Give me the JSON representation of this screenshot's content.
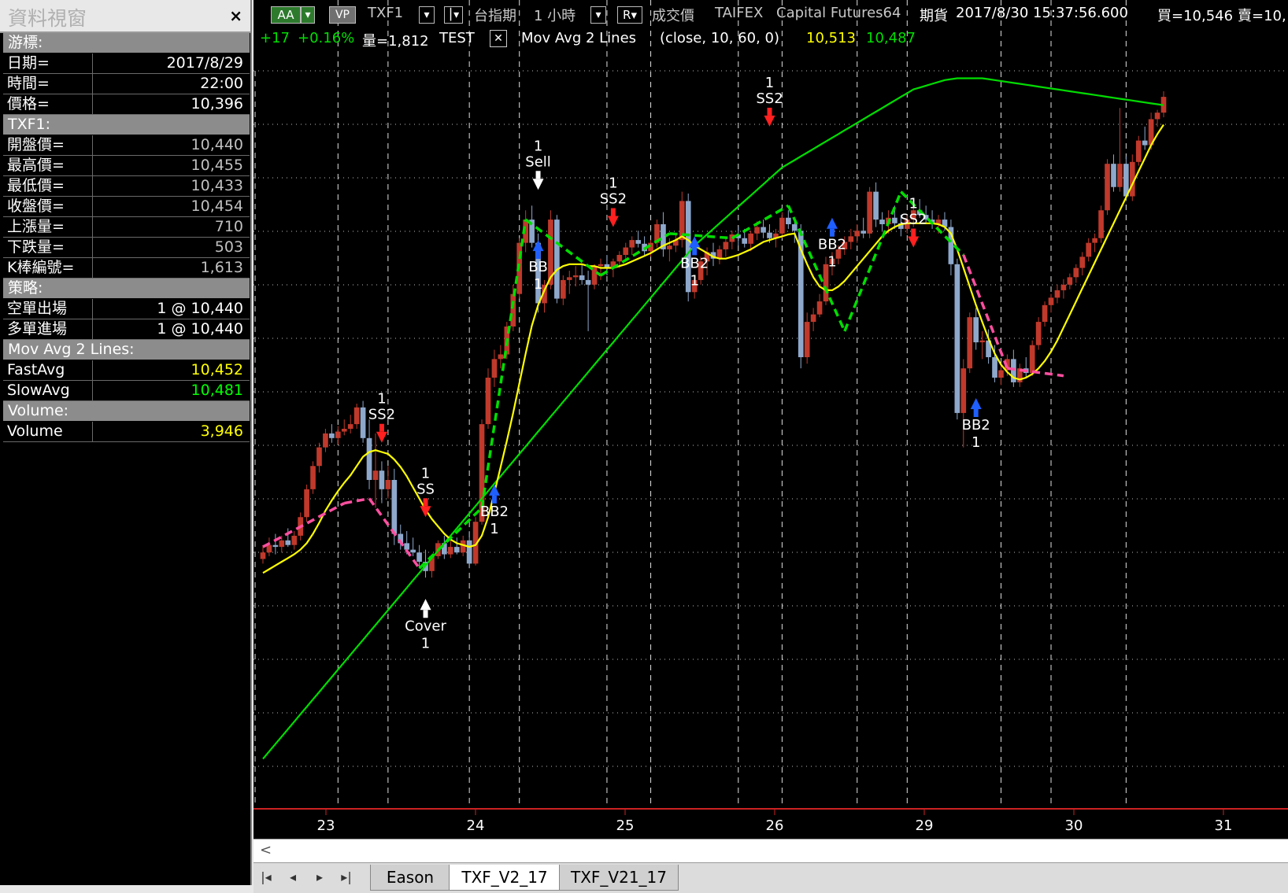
{
  "info_window": {
    "title": "資料視窗",
    "close": "×",
    "sections": [
      {
        "header": "游標:",
        "rows": [
          {
            "k": "日期=",
            "v": "2017/8/29",
            "c": "#ffffff"
          },
          {
            "k": "時間=",
            "v": "22:00",
            "c": "#ffffff"
          },
          {
            "k": "價格=",
            "v": "10,396",
            "c": "#ffffff"
          }
        ]
      },
      {
        "header": "TXF1:",
        "rows": [
          {
            "k": "開盤價=",
            "v": "10,440",
            "c": "#c0c0c0"
          },
          {
            "k": "最高價=",
            "v": "10,455",
            "c": "#c0c0c0"
          },
          {
            "k": "最低價=",
            "v": "10,433",
            "c": "#c0c0c0"
          },
          {
            "k": "收盤價=",
            "v": "10,454",
            "c": "#c0c0c0"
          },
          {
            "k": "上漲量=",
            "v": "710",
            "c": "#c0c0c0"
          },
          {
            "k": "下跌量=",
            "v": "503",
            "c": "#c0c0c0"
          },
          {
            "k": "K棒編號=",
            "v": "1,613",
            "c": "#c0c0c0"
          }
        ]
      },
      {
        "header": "策略:",
        "rows": [
          {
            "k": "空單出場",
            "v": "1 @ 10,440",
            "c": "#ffffff"
          },
          {
            "k": "多單進場",
            "v": "1 @ 10,440",
            "c": "#ffffff"
          }
        ]
      },
      {
        "header": "Mov Avg 2 Lines:",
        "rows": [
          {
            "k": "FastAvg",
            "v": "10,452",
            "c": "#ffff00"
          },
          {
            "k": "SlowAvg",
            "v": "10,481",
            "c": "#00ff00"
          }
        ]
      },
      {
        "header": "Volume:",
        "rows": [
          {
            "k": "Volume",
            "v": "3,946",
            "c": "#ffff00"
          }
        ]
      }
    ]
  },
  "header": {
    "btn_aa": "AA",
    "btn_vp": "VP",
    "symbol": "TXF1",
    "name": "台指期",
    "interval": "1 小時",
    "r": "R",
    "price_type": "成交價",
    "exchange": "TAIFEX",
    "source": "Capital Futures64",
    "kind": "期貨",
    "datetime": "2017/8/30  15:37:56.600",
    "bid": "買=10,546",
    "ask": "賣=10,"
  },
  "subheader": {
    "change": "+17",
    "change_pct": "+0.16%",
    "volume": "量=1,812",
    "strategy": "TEST",
    "close_box": "✕",
    "indicator": "Mov Avg 2 Lines",
    "params": "(close,  10,  60,  0)",
    "fast_value": "10,513",
    "slow_value": "10,487"
  },
  "tabs": [
    "Eason",
    "TXF_V2_17",
    "TXF_V21_17"
  ],
  "active_tab": 1,
  "colors": {
    "up": "#c0392b",
    "down": "#8ea8cc",
    "fast": "#ffff00",
    "slow": "#00dd00",
    "long": "#00dd00",
    "short": "#ff4fa0",
    "buy_arrow": "#1f5fff",
    "sell_arrow": "#ff2020",
    "exit_arrow": "#ffffff"
  },
  "chart_data": {
    "type": "candlestick",
    "x_ticks": [
      "23",
      "24",
      "25",
      "26",
      "29",
      "30",
      "31"
    ],
    "bars": [
      [
        10395,
        10410,
        10390,
        10402
      ],
      [
        10402,
        10418,
        10398,
        10410
      ],
      [
        10410,
        10422,
        10400,
        10408
      ],
      [
        10408,
        10420,
        10402,
        10415
      ],
      [
        10415,
        10428,
        10408,
        10410
      ],
      [
        10410,
        10425,
        10405,
        10420
      ],
      [
        10420,
        10445,
        10415,
        10440
      ],
      [
        10440,
        10475,
        10435,
        10470
      ],
      [
        10470,
        10500,
        10465,
        10495
      ],
      [
        10495,
        10520,
        10488,
        10515
      ],
      [
        10515,
        10535,
        10510,
        10530
      ],
      [
        10530,
        10540,
        10520,
        10525
      ],
      [
        10525,
        10538,
        10518,
        10532
      ],
      [
        10532,
        10545,
        10528,
        10535
      ],
      [
        10535,
        10550,
        10530,
        10540
      ],
      [
        10540,
        10562,
        10535,
        10558
      ],
      [
        10558,
        10565,
        10520,
        10525
      ],
      [
        10525,
        10545,
        10470,
        10480
      ],
      [
        10480,
        10530,
        10450,
        10490
      ],
      [
        10490,
        10500,
        10455,
        10470
      ],
      [
        10470,
        10495,
        10460,
        10480
      ],
      [
        10480,
        10492,
        10410,
        10422
      ],
      [
        10422,
        10432,
        10405,
        10412
      ],
      [
        10412,
        10425,
        10400,
        10405
      ],
      [
        10405,
        10418,
        10398,
        10402
      ],
      [
        10402,
        10410,
        10385,
        10392
      ],
      [
        10392,
        10405,
        10375,
        10382
      ],
      [
        10382,
        10400,
        10375,
        10398
      ],
      [
        10398,
        10415,
        10395,
        10412
      ],
      [
        10412,
        10420,
        10395,
        10400
      ],
      [
        10400,
        10415,
        10396,
        10408
      ],
      [
        10408,
        10418,
        10400,
        10402
      ],
      [
        10402,
        10420,
        10398,
        10415
      ],
      [
        10415,
        10425,
        10385,
        10390
      ],
      [
        10390,
        10440,
        10388,
        10435
      ],
      [
        10435,
        10545,
        10432,
        10540
      ],
      [
        10540,
        10600,
        10535,
        10590
      ],
      [
        10590,
        10620,
        10580,
        10610
      ],
      [
        10610,
        10625,
        10600,
        10615
      ],
      [
        10615,
        10650,
        10610,
        10645
      ],
      [
        10645,
        10690,
        10640,
        10680
      ],
      [
        10680,
        10740,
        10675,
        10735
      ],
      [
        10735,
        10770,
        10725,
        10760
      ],
      [
        10760,
        10775,
        10730,
        10735
      ],
      [
        10735,
        10745,
        10660,
        10670
      ],
      [
        10670,
        10695,
        10660,
        10690
      ],
      [
        10690,
        10770,
        10685,
        10760
      ],
      [
        10760,
        10765,
        10670,
        10675
      ],
      [
        10675,
        10700,
        10668,
        10695
      ],
      [
        10695,
        10705,
        10680,
        10698
      ],
      [
        10698,
        10710,
        10688,
        10700
      ],
      [
        10700,
        10712,
        10690,
        10695
      ],
      [
        10695,
        10705,
        10640,
        10690
      ],
      [
        10690,
        10712,
        10685,
        10710
      ],
      [
        10710,
        10718,
        10695,
        10712
      ],
      [
        10712,
        10722,
        10700,
        10708
      ],
      [
        10708,
        10718,
        10698,
        10715
      ],
      [
        10715,
        10726,
        10708,
        10722
      ],
      [
        10722,
        10735,
        10715,
        10730
      ],
      [
        10730,
        10742,
        10722,
        10738
      ],
      [
        10738,
        10748,
        10730,
        10734
      ],
      [
        10734,
        10742,
        10722,
        10726
      ],
      [
        10726,
        10738,
        10720,
        10735
      ],
      [
        10735,
        10760,
        10730,
        10755
      ],
      [
        10755,
        10768,
        10720,
        10728
      ],
      [
        10728,
        10740,
        10715,
        10732
      ],
      [
        10732,
        10745,
        10725,
        10738
      ],
      [
        10738,
        10790,
        10730,
        10780
      ],
      [
        10780,
        10788,
        10672,
        10682
      ],
      [
        10682,
        10700,
        10675,
        10695
      ],
      [
        10695,
        10720,
        10690,
        10715
      ],
      [
        10715,
        10730,
        10700,
        10725
      ],
      [
        10725,
        10735,
        10710,
        10718
      ],
      [
        10718,
        10732,
        10712,
        10728
      ],
      [
        10728,
        10742,
        10720,
        10736
      ],
      [
        10736,
        10748,
        10728,
        10744
      ],
      [
        10744,
        10752,
        10732,
        10740
      ],
      [
        10740,
        10750,
        10730,
        10734
      ],
      [
        10734,
        10748,
        10726,
        10745
      ],
      [
        10745,
        10758,
        10738,
        10752
      ],
      [
        10752,
        10760,
        10740,
        10746
      ],
      [
        10746,
        10755,
        10735,
        10740
      ],
      [
        10740,
        10750,
        10730,
        10745
      ],
      [
        10745,
        10768,
        10740,
        10762
      ],
      [
        10762,
        10770,
        10750,
        10755
      ],
      [
        10755,
        10762,
        10735,
        10748
      ],
      [
        10748,
        10755,
        10600,
        10612
      ],
      [
        10612,
        10660,
        10605,
        10650
      ],
      [
        10650,
        10665,
        10640,
        10658
      ],
      [
        10658,
        10680,
        10655,
        10672
      ],
      [
        10672,
        10720,
        10668,
        10712
      ],
      [
        10712,
        10725,
        10700,
        10718
      ],
      [
        10718,
        10732,
        10712,
        10728
      ],
      [
        10728,
        10742,
        10722,
        10736
      ],
      [
        10736,
        10750,
        10728,
        10742
      ],
      [
        10742,
        10755,
        10735,
        10748
      ],
      [
        10748,
        10762,
        10740,
        10745
      ],
      [
        10745,
        10795,
        10740,
        10790
      ],
      [
        10790,
        10800,
        10752,
        10760
      ],
      [
        10760,
        10768,
        10748,
        10755
      ],
      [
        10755,
        10770,
        10745,
        10762
      ],
      [
        10762,
        10775,
        10750,
        10756
      ],
      [
        10756,
        10765,
        10742,
        10750
      ],
      [
        10750,
        10765,
        10745,
        10760
      ],
      [
        10760,
        10775,
        10752,
        10770
      ],
      [
        10770,
        10782,
        10762,
        10765
      ],
      [
        10765,
        10775,
        10755,
        10760
      ],
      [
        10760,
        10770,
        10750,
        10755
      ],
      [
        10755,
        10765,
        10745,
        10760
      ],
      [
        10760,
        10768,
        10748,
        10752
      ],
      [
        10752,
        10760,
        10700,
        10712
      ],
      [
        10712,
        10718,
        10545,
        10552
      ],
      [
        10552,
        10610,
        10515,
        10600
      ],
      [
        10600,
        10660,
        10595,
        10655
      ],
      [
        10655,
        10665,
        10620,
        10628
      ],
      [
        10628,
        10640,
        10610,
        10630
      ],
      [
        10630,
        10642,
        10605,
        10612
      ],
      [
        10612,
        10625,
        10585,
        10590
      ],
      [
        10590,
        10605,
        10582,
        10598
      ],
      [
        10598,
        10615,
        10592,
        10610
      ],
      [
        10610,
        10620,
        10580,
        10585
      ],
      [
        10585,
        10605,
        10580,
        10600
      ],
      [
        10600,
        10612,
        10590,
        10595
      ],
      [
        10595,
        10630,
        10592,
        10625
      ],
      [
        10625,
        10655,
        10620,
        10650
      ],
      [
        10650,
        10672,
        10645,
        10668
      ],
      [
        10668,
        10680,
        10660,
        10676
      ],
      [
        10676,
        10690,
        10670,
        10684
      ],
      [
        10684,
        10696,
        10675,
        10690
      ],
      [
        10690,
        10702,
        10685,
        10698
      ],
      [
        10698,
        10712,
        10692,
        10708
      ],
      [
        10708,
        10725,
        10700,
        10720
      ],
      [
        10720,
        10740,
        10715,
        10735
      ],
      [
        10735,
        10745,
        10725,
        10740
      ],
      [
        10740,
        10775,
        10735,
        10770
      ],
      [
        10770,
        10825,
        10765,
        10820
      ],
      [
        10820,
        10830,
        10790,
        10795
      ],
      [
        10795,
        10880,
        10790,
        10820
      ],
      [
        10820,
        10828,
        10780,
        10785
      ],
      [
        10785,
        10830,
        10780,
        10822
      ],
      [
        10822,
        10850,
        10818,
        10845
      ],
      [
        10845,
        10860,
        10835,
        10840
      ],
      [
        10840,
        10875,
        10835,
        10868
      ],
      [
        10868,
        10878,
        10860,
        10875
      ],
      [
        10875,
        10898,
        10870,
        10892
      ]
    ],
    "fast_avg": [
      10380,
      10384,
      10388,
      10392,
      10396,
      10400,
      10405,
      10412,
      10422,
      10434,
      10447,
      10458,
      10468,
      10477,
      10485,
      10495,
      10505,
      10510,
      10512,
      10510,
      10508,
      10502,
      10494,
      10484,
      10472,
      10460,
      10448,
      10438,
      10430,
      10422,
      10416,
      10412,
      10410,
      10408,
      10410,
      10420,
      10440,
      10466,
      10494,
      10522,
      10552,
      10584,
      10616,
      10646,
      10668,
      10684,
      10698,
      10706,
      10710,
      10712,
      10712,
      10712,
      10710,
      10710,
      10708,
      10708,
      10708,
      10710,
      10712,
      10715,
      10718,
      10721,
      10724,
      10728,
      10732,
      10735,
      10738,
      10742,
      10738,
      10732,
      10728,
      10724,
      10720,
      10718,
      10718,
      10720,
      10722,
      10725,
      10728,
      10732,
      10736,
      10738,
      10740,
      10742,
      10744,
      10745,
      10728,
      10712,
      10698,
      10688,
      10684,
      10684,
      10688,
      10694,
      10702,
      10710,
      10718,
      10726,
      10734,
      10742,
      10748,
      10752,
      10755,
      10756,
      10756,
      10756,
      10756,
      10756,
      10755,
      10752,
      10745,
      10728,
      10708,
      10688,
      10668,
      10650,
      10632,
      10616,
      10604,
      10596,
      10590,
      10588,
      10590,
      10594,
      10600,
      10608,
      10618,
      10630,
      10644,
      10658,
      10672,
      10686,
      10700,
      10714,
      10728,
      10742,
      10756,
      10770,
      10784,
      10798,
      10812,
      10826,
      10840,
      10852,
      10862
    ],
    "slow_avg": [
      10180,
      10188,
      10196,
      10204,
      10212,
      10220,
      10228,
      10236,
      10244,
      10252,
      10260,
      10268,
      10276,
      10284,
      10292,
      10300,
      10308,
      10316,
      10324,
      10332,
      10340,
      10348,
      10356,
      10364,
      10372,
      10380,
      10388,
      10396,
      10404,
      10412,
      10420,
      10428,
      10436,
      10444,
      10452,
      10460,
      10468,
      10476,
      10484,
      10492,
      10500,
      10508,
      10516,
      10524,
      10532,
      10540,
      10548,
      10556,
      10564,
      10572,
      10580,
      10588,
      10596,
      10604,
      10612,
      10620,
      10628,
      10636,
      10644,
      10652,
      10660,
      10668,
      10676,
      10684,
      10692,
      10700,
      10708,
      10716,
      10724,
      10732,
      10738,
      10744,
      10750,
      10756,
      10762,
      10768,
      10774,
      10780,
      10786,
      10792,
      10798,
      10804,
      10810,
      10816,
      10820,
      10824,
      10828,
      10832,
      10836,
      10840,
      10844,
      10848,
      10852,
      10856,
      10860,
      10864,
      10868,
      10872,
      10876,
      10880,
      10884,
      10888,
      10892,
      10896,
      10900,
      10902,
      10904,
      10906,
      10908,
      10910,
      10911,
      10912,
      10912,
      10912,
      10912,
      10912,
      10911,
      10910,
      10909,
      10908,
      10907,
      10906,
      10905,
      10904,
      10903,
      10902,
      10901,
      10900,
      10899,
      10898,
      10897,
      10896,
      10895,
      10894,
      10893,
      10892,
      10891,
      10890,
      10889,
      10888,
      10887,
      10886,
      10885,
      10884,
      10883
    ]
  },
  "signals": [
    {
      "label": "SS2",
      "qty": "1",
      "kind": "sell"
    },
    {
      "label": "SS",
      "qty": "1",
      "kind": "sell"
    },
    {
      "label": "Cover",
      "qty": "1",
      "kind": "exit_short"
    },
    {
      "label": "BB2",
      "qty": "1",
      "kind": "buy"
    },
    {
      "label": "Sell",
      "qty": "1",
      "kind": "exit_long"
    },
    {
      "label": "BB",
      "qty": "1",
      "kind": "buy"
    },
    {
      "label": "SS2",
      "qty": "1",
      "kind": "sell"
    },
    {
      "label": "BB2",
      "qty": "1",
      "kind": "buy"
    },
    {
      "label": "SS2",
      "qty": "1",
      "kind": "sell"
    },
    {
      "label": "BB2",
      "qty": "1",
      "kind": "buy"
    },
    {
      "label": "SS2",
      "qty": "1",
      "kind": "sell"
    },
    {
      "label": "BB2",
      "qty": "1",
      "kind": "buy"
    }
  ]
}
